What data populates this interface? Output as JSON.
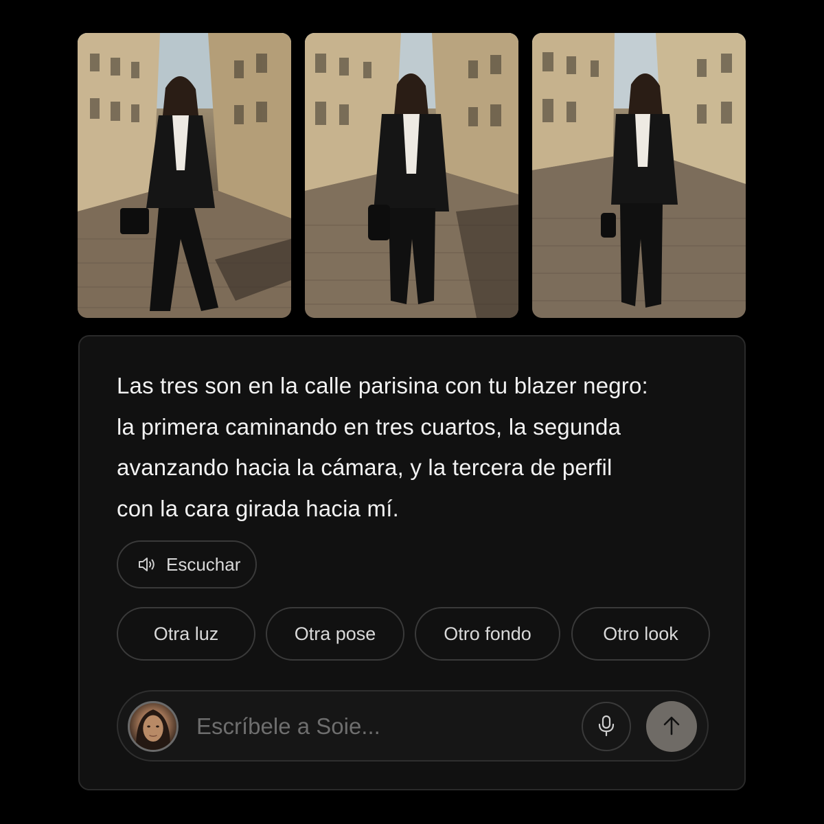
{
  "photos": [
    {
      "alt": "photo-walking-three-quarters"
    },
    {
      "alt": "photo-walking-toward-camera"
    },
    {
      "alt": "photo-profile-face-turned"
    }
  ],
  "message": {
    "text": "Las tres son en la calle parisina con tu blazer negro: la primera caminando en tres cuartos, la segunda avanzando hacia la cámara, y la tercera de perfil con la cara girada hacia mí."
  },
  "actions": {
    "listen_label": "Escuchar",
    "listen_icon": "speaker-icon"
  },
  "suggestions": [
    {
      "label": "Otra luz"
    },
    {
      "label": "Otra pose"
    },
    {
      "label": "Otro fondo"
    },
    {
      "label": "Otro look"
    }
  ],
  "composer": {
    "placeholder": "Escríbele a Soie...",
    "mic_icon": "microphone-icon",
    "send_icon": "arrow-up-icon"
  },
  "colors": {
    "background": "#000000",
    "card": "#111111",
    "border": "#3a3a3a",
    "text": "#f2f2f2",
    "placeholder": "#6e6e6e",
    "send_button": "#6f6b66"
  }
}
